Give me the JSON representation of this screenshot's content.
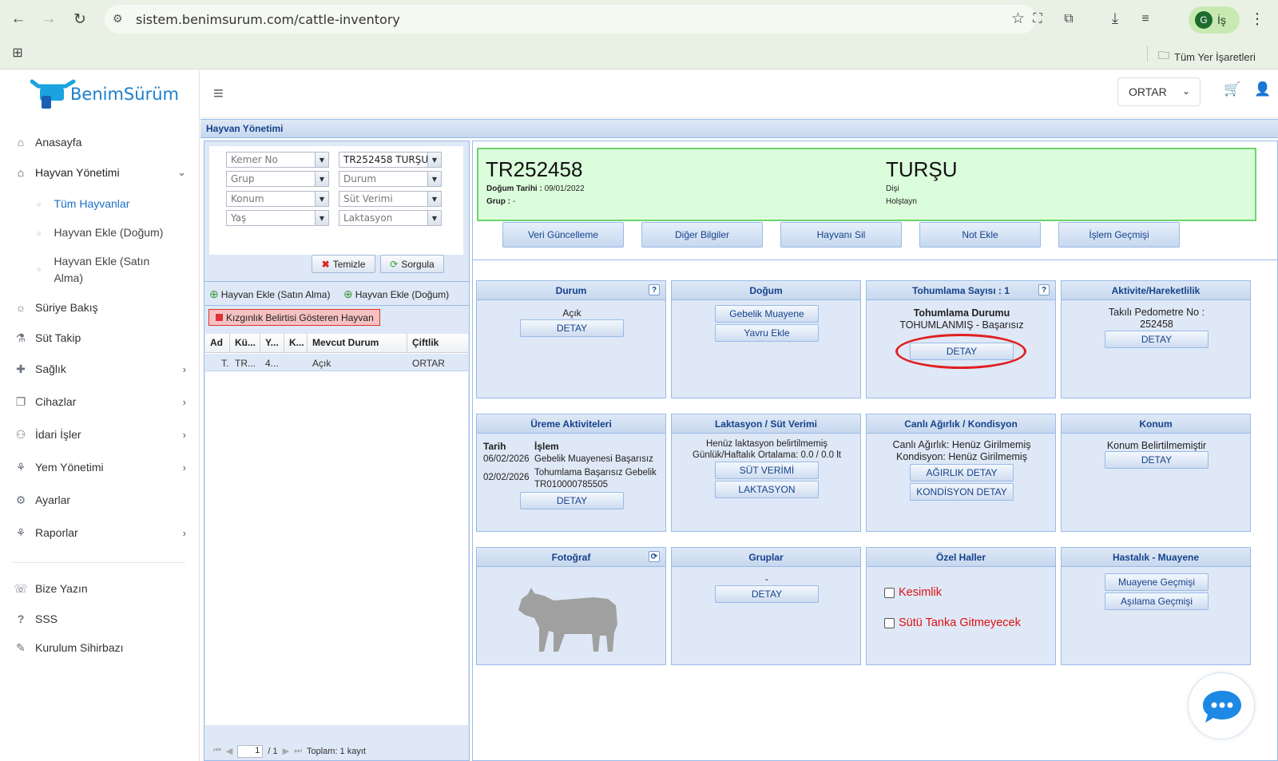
{
  "browser": {
    "url": "sistem.benimsurum.com/cattle-inventory",
    "profile_letter": "G",
    "profile_label": "İş",
    "bookmarks_label": "Tüm Yer İşaretleri"
  },
  "logo": {
    "brand": "BenimSürüm"
  },
  "sidebar": {
    "items": [
      {
        "label": "Anasayfa"
      },
      {
        "label": "Hayvan Yönetimi"
      },
      {
        "label": "Süriye Bakış"
      },
      {
        "label": "Süt Takip"
      },
      {
        "label": "Sağlık"
      },
      {
        "label": "Cihazlar"
      },
      {
        "label": "İdari İşler"
      },
      {
        "label": "Yem Yönetimi"
      },
      {
        "label": "Ayarlar"
      },
      {
        "label": "Raporlar"
      },
      {
        "label": "Bize Yazın"
      },
      {
        "label": "SSS"
      },
      {
        "label": "Kurulum Sihirbazı"
      }
    ],
    "subitems": [
      {
        "label": "Tüm Hayvanlar"
      },
      {
        "label": "Hayvan Ekle (Doğum)"
      },
      {
        "label": "Hayvan Ekle (Satın Alma)"
      }
    ]
  },
  "topbar": {
    "farm": "ORTAR"
  },
  "panel": {
    "title": "Hayvan Yönetimi"
  },
  "filters": {
    "kemer_no": "Kemer No",
    "animal": "TR252458 TURŞU",
    "grup": "Grup",
    "durum": "Durum",
    "konum": "Konum",
    "sut_verimi": "Süt Verimi",
    "yas": "Yaş",
    "laktasyon": "Laktasyon",
    "clear_label": "Temizle",
    "query_label": "Sorgula",
    "add_purchase": "Hayvan Ekle (Satın Alma)",
    "add_birth": "Hayvan Ekle (Doğum)",
    "heat_label": "Kızgınlık Belirtisi Gösteren Hayvan"
  },
  "grid": {
    "headers": [
      "Ad",
      "Kü...",
      "Y...",
      "K...",
      "Mevcut Durum",
      "Çiftlik"
    ],
    "rows": [
      [
        "T.",
        "TR...",
        "4...",
        "",
        "Açık",
        "ORTAR"
      ]
    ],
    "page": "1",
    "page_of": "/ 1",
    "total": "Toplam: 1 kayıt"
  },
  "animal": {
    "id": "TR252458",
    "birth_label": "Doğum Tarihi :",
    "birth_date": "09/01/2022",
    "group_label": "Grup :",
    "group": "-",
    "name": "TURŞU",
    "sex": "Dişi",
    "breed": "Holştayn"
  },
  "actions": [
    "Veri Güncelleme",
    "Diğer Bilgiler",
    "Hayvanı Sil",
    "Not Ekle",
    "İşlem Geçmişi"
  ],
  "cards": {
    "durum": {
      "title": "Durum",
      "value": "Açık",
      "button": "DETAY"
    },
    "dogum": {
      "title": "Doğum",
      "btn1": "Gebelik Muayene",
      "btn2": "Yavru Ekle"
    },
    "tohumlama": {
      "title": "Tohumlama Sayısı : 1",
      "heading": "Tohumlama Durumu",
      "status": "TOHUMLANMIŞ - Başarısız",
      "button": "DETAY"
    },
    "aktivite": {
      "title": "Aktivite/Hareketlilik",
      "pedometer": "Takılı Pedometre No :",
      "pedometer_no": "252458",
      "button": "DETAY"
    },
    "ureme": {
      "title": "Üreme Aktiviteleri",
      "col_date": "Tarih",
      "col_op": "İşlem",
      "rows": [
        {
          "date": "06/02/2026",
          "op": "Gebelik Muayenesi Başarısız"
        },
        {
          "date": "02/02/2026",
          "op": "Tohumlama Başarısız Gebelik TR010000785505"
        }
      ],
      "button": "DETAY"
    },
    "laktasyon": {
      "title": "Laktasyon / Süt Verimi",
      "line1": "Henüz laktasyon belirtilmemiş",
      "line2": "Günlük/Haftalık Ortalama: 0.0 / 0.0 lt",
      "btn1": "SÜT VERİMİ",
      "btn2": "LAKTASYON"
    },
    "agirlik": {
      "title": "Canlı Ağırlık / Kondisyon",
      "line1": "Canlı Ağırlık: Henüz Girilmemiş",
      "line2": "Kondisyon: Henüz Girilmemiş",
      "btn1": "AĞIRLIK DETAY",
      "btn2": "KONDİSYON DETAY"
    },
    "konum": {
      "title": "Konum",
      "line1": "Konum Belirtilmemiştir",
      "button": "DETAY"
    },
    "fotograf": {
      "title": "Fotoğraf"
    },
    "gruplar": {
      "title": "Gruplar",
      "value": "-",
      "button": "DETAY"
    },
    "ozel": {
      "title": "Özel Haller",
      "opt1": "Kesimlik",
      "opt2": "Sütü Tanka Gitmeyecek"
    },
    "hastalik": {
      "title": "Hastalık - Muayene",
      "btn1": "Muayene Geçmişi",
      "btn2": "Aşılama Geçmişi"
    }
  },
  "colors": {
    "accent": "#15428b",
    "header_green": "#dcfddc",
    "alert_red": "#dd1111",
    "annotation": "#e02020"
  }
}
